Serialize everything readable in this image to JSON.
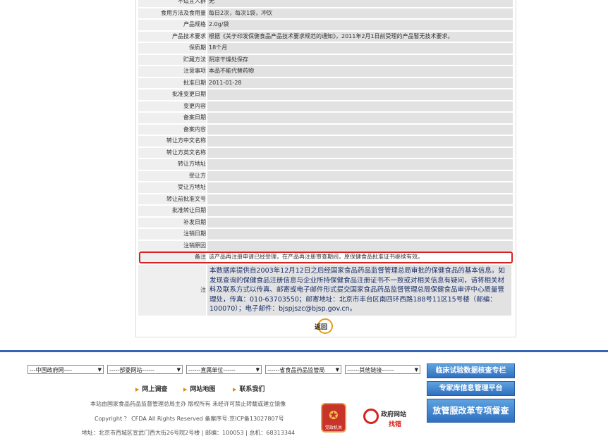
{
  "rows": [
    {
      "label": "不适宜人群",
      "value": "无"
    },
    {
      "label": "食用方法及食用量",
      "value": "每日2次，每次1袋，冲饮"
    },
    {
      "label": "产品规格",
      "value": "2.0g/袋"
    },
    {
      "label": "产品技术要求",
      "value": "根据《关于印发保健食品产品技术要求规范的通知》，2011年2月1日前受理的产品暂无技术要求。"
    },
    {
      "label": "保质期",
      "value": "18个月"
    },
    {
      "label": "贮藏方法",
      "value": "阴凉干燥处保存"
    },
    {
      "label": "注意事项",
      "value": "本品不能代替药物"
    },
    {
      "label": "批准日期",
      "value": "2011-01-28"
    },
    {
      "label": "批准变更日期",
      "value": ""
    },
    {
      "label": "变更内容",
      "value": ""
    },
    {
      "label": "备案日期",
      "value": ""
    },
    {
      "label": "备案内容",
      "value": ""
    },
    {
      "label": "转让方中文名称",
      "value": ""
    },
    {
      "label": "转让方英文名称",
      "value": ""
    },
    {
      "label": "转让方地址",
      "value": ""
    },
    {
      "label": "受让方",
      "value": ""
    },
    {
      "label": "受让方地址",
      "value": ""
    },
    {
      "label": "转让前批准文号",
      "value": ""
    },
    {
      "label": "批准转让日期",
      "value": ""
    },
    {
      "label": "补发日期",
      "value": ""
    },
    {
      "label": "注销日期",
      "value": ""
    },
    {
      "label": "注销原因",
      "value": ""
    },
    {
      "label": "备注",
      "value": "该产品再注册申请已经受理，在产品再注册审查期间，原保健食品批准证书继续有效。"
    }
  ],
  "note": {
    "label": "注",
    "text": "本数据库提供自2003年12月12日之后经国家食品药品监督管理总局审批的保健食品的基本信息。如发现查询的保健食品注册信息与企业所持保健食品注册证书不一致或对相关信息有疑问，请将相关材料及联系方式以传真、邮寄或电子邮件形式提交国家食品药品监督管理总局保健食品审评中心质量管理处，传真：010-63703550；邮寄地址：北京市丰台区南四环西路188号11区15号楼（邮编：100070）；电子邮件：bjspjszc@bjsp.gov.cn。"
  },
  "back_label": "返回",
  "footer": {
    "selects": [
      "---中国政府网----",
      "-----部委网站------",
      "------直属单位------",
      "------省食品药品监管局",
      "------其他链接------"
    ],
    "links": [
      "网上调查",
      "网站地图",
      "联系我们"
    ],
    "line1": "本站由国家食品药品监督管理总局主办 版权所有 未经许可禁止转载或建立镜像",
    "line2": "Copyright ？ CFDA All Rights Reserved    备案序号:京ICP备13027807号",
    "line3": "地址：北京市西城区宣武门西大街26号院2号楼 | 邮编：100053 | 总机：68313344",
    "badge_text": "党政机关",
    "gov_title": "政府网站",
    "gov_sub": "找错",
    "buttons": [
      "临床试验数据核查专栏",
      "专家库信息管理平台",
      "放管服改革专项督查"
    ]
  },
  "colors": {
    "accent": "#3466b5",
    "highlight_border": "#d7231f",
    "note_text": "#1a2f6b"
  }
}
